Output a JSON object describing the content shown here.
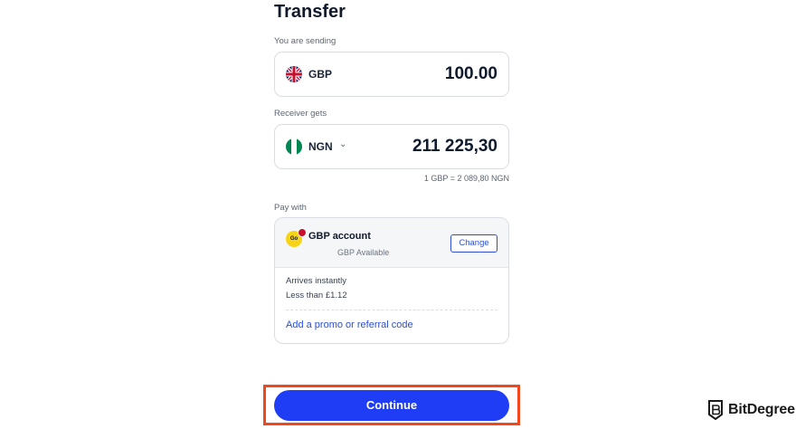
{
  "header": {
    "title": "Transfer"
  },
  "send": {
    "label": "You are sending",
    "currency": "GBP",
    "amount": "100.00",
    "flag_icon": "uk-flag-icon"
  },
  "receive": {
    "label": "Receiver gets",
    "currency": "NGN",
    "amount": "211 225,30",
    "flag_icon": "nigeria-flag-icon",
    "rate": "1 GBP = 2 089,80 NGN"
  },
  "pay": {
    "label": "Pay with",
    "account_name": "GBP account",
    "account_sub": "GBP Available",
    "account_icon_text": "Go",
    "change_label": "Change",
    "arrives": "Arrives instantly",
    "fee": "Less than £1.12",
    "promo": "Add a promo or referral code"
  },
  "actions": {
    "continue_label": "Continue"
  },
  "watermark": {
    "text": "BitDegree"
  },
  "colors": {
    "primary": "#1e3df5",
    "link": "#2a4fd6",
    "highlight": "#f0471f",
    "text": "#0f1b2d"
  }
}
